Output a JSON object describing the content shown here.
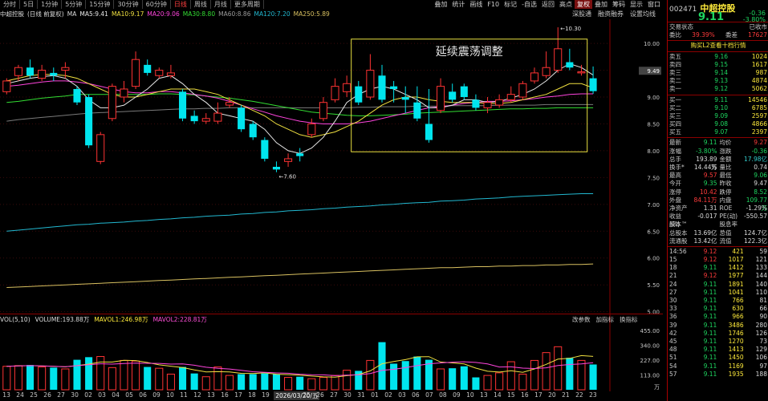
{
  "tabs": [
    "分时",
    "5日",
    "1分钟",
    "5分钟",
    "15分钟",
    "30分钟",
    "60分钟",
    "日线",
    "周线",
    "月线",
    "更多周期"
  ],
  "active_tab": "日线",
  "tools": [
    {
      "label": "叠加",
      "hl": false
    },
    {
      "label": "统计",
      "hl": false
    },
    {
      "label": "画线",
      "hl": false
    },
    {
      "label": "F10",
      "hl": false
    },
    {
      "label": "标记",
      "hl": false
    },
    {
      "label": "-自选",
      "hl": false
    },
    {
      "label": "返回",
      "hl": false
    },
    {
      "label": "高点",
      "hl": false
    },
    {
      "label": "复权",
      "hl": true
    },
    {
      "label": "叠加",
      "hl": false
    },
    {
      "label": "筹码",
      "hl": false
    },
    {
      "label": "显示",
      "hl": false
    },
    {
      "label": "窗口",
      "hl": false
    }
  ],
  "legend": {
    "name": "中超控股",
    "period": "(日线 前复权)",
    "ma": "MA",
    "ma5": "MA5:9.41",
    "ma10": "MA10:9.17",
    "ma20": "MA20:9.06",
    "ma30": "MA30:8.80",
    "ma60": "MA60:8.86",
    "ma120": "MA120:7.20",
    "ma250": "MA250:5.89"
  },
  "subbar": [
    "深股通",
    "融资融券",
    "设置均线"
  ],
  "annotation": "延续震荡调整",
  "price_labels": {
    "high": "10.30",
    "low": "7.60"
  },
  "yaxis": [
    "10.00",
    "9.50",
    "9.00",
    "8.50",
    "8.00",
    "7.50",
    "7.00",
    "6.50",
    "6.00",
    "5.50",
    "5.00"
  ],
  "current_price_tag": "9.49",
  "vol_legend": {
    "vol": "VOL(5,10)",
    "volume": "VOLUME:193.88万",
    "mavol1": "MAVOL1:246.98万",
    "mavol2": "MAVOL2:228.81万"
  },
  "vol_tools": [
    "改参数",
    "加指标",
    "换指标"
  ],
  "vol_yaxis": [
    "455.00",
    "340.00",
    "227.00",
    "113.00"
  ],
  "vol_unit": "万",
  "dates": [
    "13",
    "24",
    "25",
    "26",
    "27",
    "30",
    "02",
    "03",
    "04",
    "05",
    "06",
    "09",
    "10",
    "11",
    "12",
    "13",
    "16",
    "17",
    "18",
    "19",
    "20",
    "2026/03/20/五",
    "25",
    "26",
    "27",
    "30",
    "31",
    "01",
    "02",
    "03",
    "06",
    "07",
    "08",
    "09",
    "10",
    "13",
    "14",
    "15",
    "16",
    "17",
    "20",
    "21",
    "22",
    "23"
  ],
  "stock": {
    "code": "002471",
    "name": "中超控股",
    "price": "9.11",
    "change": "-0.36",
    "pct": "-3.80%"
  },
  "status": {
    "label": "交易状态",
    "value": "已收市"
  },
  "weibi": {
    "k1": "委比",
    "v1": "39.39%",
    "k2": "委差",
    "v2": "17627"
  },
  "l2": "购买L2查看十档行情",
  "asks": [
    {
      "l": "卖五",
      "p": "9.16",
      "v": "1024"
    },
    {
      "l": "卖四",
      "p": "9.15",
      "v": "1617"
    },
    {
      "l": "卖三",
      "p": "9.14",
      "v": "987"
    },
    {
      "l": "卖二",
      "p": "9.13",
      "v": "4874"
    },
    {
      "l": "卖一",
      "p": "9.12",
      "v": "5062"
    }
  ],
  "bids": [
    {
      "l": "买一",
      "p": "9.11",
      "v": "14546"
    },
    {
      "l": "买二",
      "p": "9.10",
      "v": "6785"
    },
    {
      "l": "买三",
      "p": "9.09",
      "v": "2597"
    },
    {
      "l": "买四",
      "p": "9.08",
      "v": "4866"
    },
    {
      "l": "买五",
      "p": "9.07",
      "v": "2397"
    }
  ],
  "stats": [
    {
      "k1": "最新",
      "v1": "9.11",
      "c1": "green",
      "k2": "均价",
      "v2": "9.27",
      "c2": "red"
    },
    {
      "k1": "涨幅",
      "v1": "-3.80%",
      "c1": "green",
      "k2": "涨跌",
      "v2": "-0.36",
      "c2": "green"
    },
    {
      "k1": "总手",
      "v1": "193.89万",
      "c1": "white",
      "k2": "金额",
      "v2": "17.98亿",
      "c2": "cyan"
    },
    {
      "k1": "换手*",
      "v1": "14.44%",
      "c1": "white",
      "k2": "量比",
      "v2": "0.74",
      "c2": "white"
    },
    {
      "k1": "最高",
      "v1": "9.57",
      "c1": "red",
      "k2": "最低",
      "v2": "9.06",
      "c2": "green"
    },
    {
      "k1": "今开",
      "v1": "9.35",
      "c1": "green",
      "k2": "昨收",
      "v2": "9.47",
      "c2": "white"
    },
    {
      "k1": "涨停",
      "v1": "10.42",
      "c1": "red",
      "k2": "跌停",
      "v2": "8.52",
      "c2": "green"
    },
    {
      "k1": "外盘",
      "v1": "84.11万",
      "c1": "red",
      "k2": "内盘",
      "v2": "109.77万",
      "c2": "green"
    },
    {
      "k1": "净资产",
      "v1": "1.31",
      "c1": "white",
      "k2": "ROE",
      "v2": "-1.29%",
      "c2": "white"
    },
    {
      "k1": "收益(四)",
      "v1": "-0.017",
      "c1": "white",
      "k2": "PE(动)",
      "v2": "-550.57",
      "c2": "white"
    },
    {
      "k1": "股本™",
      "v1": "",
      "c1": "white",
      "k2": "股息率™",
      "v2": "",
      "c2": "white"
    },
    {
      "k1": "总股本",
      "v1": "13.69亿",
      "c1": "white",
      "k2": "总值",
      "v2": "124.7亿",
      "c2": "white"
    },
    {
      "k1": "流通股",
      "v1": "13.42亿",
      "c1": "white",
      "k2": "流值",
      "v2": "122.3亿",
      "c2": "white"
    }
  ],
  "ticks": [
    {
      "t": "14:56",
      "p": "9.12",
      "v": "421",
      "c": "59",
      "pc": "red"
    },
    {
      "t": "15",
      "p": "9.12",
      "v": "1017",
      "c": "121",
      "pc": "red"
    },
    {
      "t": "18",
      "p": "9.11",
      "v": "1412",
      "c": "133",
      "pc": "green"
    },
    {
      "t": "21",
      "p": "9.12",
      "v": "1977",
      "c": "144",
      "pc": "red"
    },
    {
      "t": "24",
      "p": "9.11",
      "v": "1891",
      "c": "140",
      "pc": "green"
    },
    {
      "t": "27",
      "p": "9.11",
      "v": "1041",
      "c": "110",
      "pc": "green"
    },
    {
      "t": "30",
      "p": "9.11",
      "v": "766",
      "c": "81",
      "pc": "green"
    },
    {
      "t": "33",
      "p": "9.11",
      "v": "630",
      "c": "66",
      "pc": "green"
    },
    {
      "t": "36",
      "p": "9.11",
      "v": "966",
      "c": "90",
      "pc": "green"
    },
    {
      "t": "39",
      "p": "9.11",
      "v": "3486",
      "c": "280",
      "pc": "green"
    },
    {
      "t": "42",
      "p": "9.11",
      "v": "1746",
      "c": "126",
      "pc": "green"
    },
    {
      "t": "45",
      "p": "9.11",
      "v": "1270",
      "c": "73",
      "pc": "green"
    },
    {
      "t": "48",
      "p": "9.11",
      "v": "1413",
      "c": "129",
      "pc": "green"
    },
    {
      "t": "51",
      "p": "9.11",
      "v": "1450",
      "c": "106",
      "pc": "green"
    },
    {
      "t": "54",
      "p": "9.11",
      "v": "1169",
      "c": "97",
      "pc": "green"
    },
    {
      "t": "57",
      "p": "9.11",
      "v": "1935",
      "c": "188",
      "pc": "green"
    }
  ],
  "chart_data": {
    "type": "candlestick",
    "ylim": [
      4.95,
      10.45
    ],
    "vol_ylim": [
      0,
      455
    ],
    "candles": [
      {
        "o": 9.1,
        "c": 9.3,
        "h": 9.35,
        "l": 9.05
      },
      {
        "o": 9.4,
        "c": 9.55,
        "h": 9.6,
        "l": 9.3
      },
      {
        "o": 9.55,
        "c": 9.4,
        "h": 9.7,
        "l": 9.35
      },
      {
        "o": 9.35,
        "c": 9.5,
        "h": 9.6,
        "l": 9.3
      },
      {
        "o": 9.45,
        "c": 9.4,
        "h": 9.55,
        "l": 9.3
      },
      {
        "o": 9.5,
        "c": 9.55,
        "h": 9.65,
        "l": 9.35
      },
      {
        "o": 9.15,
        "c": 8.9,
        "h": 9.2,
        "l": 8.85
      },
      {
        "o": 9.0,
        "c": 8.1,
        "h": 9.05,
        "l": 8.05
      },
      {
        "o": 7.8,
        "c": 8.3,
        "h": 8.35,
        "l": 7.75
      },
      {
        "o": 8.6,
        "c": 9.2,
        "h": 9.25,
        "l": 8.55
      },
      {
        "o": 9.0,
        "c": 9.15,
        "h": 9.3,
        "l": 8.9
      },
      {
        "o": 9.2,
        "c": 9.7,
        "h": 9.85,
        "l": 9.15
      },
      {
        "o": 9.6,
        "c": 9.45,
        "h": 9.7,
        "l": 9.4
      },
      {
        "o": 9.4,
        "c": 9.5,
        "h": 9.55,
        "l": 9.35
      },
      {
        "o": 9.4,
        "c": 9.45,
        "h": 9.6,
        "l": 9.35
      },
      {
        "o": 9.1,
        "c": 8.6,
        "h": 9.15,
        "l": 8.55
      },
      {
        "o": 8.65,
        "c": 8.55,
        "h": 8.75,
        "l": 8.5
      },
      {
        "o": 8.55,
        "c": 8.6,
        "h": 8.7,
        "l": 8.5
      },
      {
        "o": 8.55,
        "c": 8.7,
        "h": 8.9,
        "l": 8.5
      },
      {
        "o": 8.85,
        "c": 8.9,
        "h": 9.0,
        "l": 8.8
      },
      {
        "o": 8.8,
        "c": 8.4,
        "h": 8.85,
        "l": 8.35
      },
      {
        "o": 8.5,
        "c": 8.25,
        "h": 8.55,
        "l": 8.2
      },
      {
        "o": 8.2,
        "c": 7.85,
        "h": 8.25,
        "l": 7.8
      },
      {
        "o": 7.7,
        "c": 7.65,
        "h": 7.8,
        "l": 7.6
      },
      {
        "o": 7.8,
        "c": 7.85,
        "h": 7.95,
        "l": 7.7
      },
      {
        "o": 7.95,
        "c": 7.9,
        "h": 8.05,
        "l": 7.8
      },
      {
        "o": 8.3,
        "c": 8.5,
        "h": 8.6,
        "l": 8.25
      },
      {
        "o": 8.6,
        "c": 8.9,
        "h": 9.0,
        "l": 8.55
      },
      {
        "o": 8.95,
        "c": 9.2,
        "h": 9.35,
        "l": 8.9
      },
      {
        "o": 9.1,
        "c": 9.25,
        "h": 9.4,
        "l": 9.0
      },
      {
        "o": 9.2,
        "c": 8.9,
        "h": 9.3,
        "l": 8.85
      },
      {
        "o": 9.0,
        "c": 9.5,
        "h": 9.8,
        "l": 8.95
      },
      {
        "o": 9.4,
        "c": 8.95,
        "h": 9.6,
        "l": 8.9
      },
      {
        "o": 9.2,
        "c": 9.15,
        "h": 9.3,
        "l": 8.9
      },
      {
        "o": 9.0,
        "c": 8.95,
        "h": 9.2,
        "l": 8.7
      },
      {
        "o": 8.9,
        "c": 8.6,
        "h": 9.2,
        "l": 8.55
      },
      {
        "o": 8.5,
        "c": 8.2,
        "h": 9.15,
        "l": 8.15
      },
      {
        "o": 8.75,
        "c": 9.2,
        "h": 9.35,
        "l": 8.7
      },
      {
        "o": 9.1,
        "c": 8.95,
        "h": 9.25,
        "l": 8.9
      },
      {
        "o": 9.2,
        "c": 9.0,
        "h": 9.25,
        "l": 8.95
      },
      {
        "o": 8.95,
        "c": 8.8,
        "h": 9.05,
        "l": 8.75
      },
      {
        "o": 8.8,
        "c": 8.9,
        "h": 9.0,
        "l": 8.7
      },
      {
        "o": 8.85,
        "c": 8.95,
        "h": 9.05,
        "l": 8.8
      },
      {
        "o": 8.95,
        "c": 9.05,
        "h": 9.2,
        "l": 8.9
      },
      {
        "o": 9.0,
        "c": 9.25,
        "h": 9.3,
        "l": 8.95
      },
      {
        "o": 9.3,
        "c": 9.45,
        "h": 9.55,
        "l": 9.25
      },
      {
        "o": 9.4,
        "c": 9.55,
        "h": 9.85,
        "l": 9.35
      },
      {
        "o": 9.5,
        "c": 9.9,
        "h": 10.3,
        "l": 9.45
      },
      {
        "o": 9.65,
        "c": 9.55,
        "h": 9.9,
        "l": 9.5
      },
      {
        "o": 9.45,
        "c": 9.47,
        "h": 9.6,
        "l": 9.4
      },
      {
        "o": 9.35,
        "c": 9.11,
        "h": 9.57,
        "l": 9.06
      }
    ],
    "volumes": [
      180,
      185,
      190,
      175,
      170,
      160,
      230,
      250,
      255,
      170,
      225,
      220,
      175,
      165,
      120,
      175,
      125,
      100,
      175,
      110,
      120,
      120,
      125,
      120,
      95,
      100,
      85,
      95,
      110,
      150,
      145,
      225,
      365,
      200,
      220,
      255,
      230,
      160,
      165,
      180,
      95,
      110,
      130,
      215,
      120,
      225,
      285,
      330,
      245,
      225,
      193.88
    ],
    "ma5": [
      9.25,
      9.3,
      9.35,
      9.38,
      9.4,
      9.35,
      9.2,
      8.95,
      8.8,
      8.8,
      8.85,
      9.0,
      9.15,
      9.35,
      9.4,
      9.25,
      9.05,
      8.9,
      8.7,
      8.65,
      8.6,
      8.55,
      8.4,
      8.15,
      8.0,
      7.95,
      8.05,
      8.25,
      8.55,
      8.9,
      9.05,
      9.15,
      9.2,
      9.15,
      9.05,
      8.95,
      8.8,
      8.8,
      8.85,
      8.95,
      8.95,
      8.9,
      8.92,
      8.98,
      9.05,
      9.15,
      9.3,
      9.5,
      9.62,
      9.55,
      9.41
    ],
    "ma10": [
      9.3,
      9.35,
      9.4,
      9.42,
      9.42,
      9.4,
      9.35,
      9.25,
      9.15,
      9.05,
      9.0,
      9.0,
      9.05,
      9.1,
      9.15,
      9.15,
      9.15,
      9.1,
      9.05,
      8.95,
      8.85,
      8.75,
      8.65,
      8.5,
      8.4,
      8.3,
      8.25,
      8.3,
      8.35,
      8.45,
      8.55,
      8.7,
      8.85,
      8.95,
      9.0,
      9.0,
      8.95,
      8.92,
      8.9,
      8.9,
      8.9,
      8.88,
      8.88,
      8.9,
      8.95,
      9.0,
      9.05,
      9.15,
      9.25,
      9.25,
      9.17
    ],
    "ma20": [
      9.2,
      9.22,
      9.25,
      9.28,
      9.3,
      9.3,
      9.28,
      9.25,
      9.2,
      9.15,
      9.1,
      9.08,
      9.08,
      9.1,
      9.1,
      9.08,
      9.05,
      9.02,
      8.98,
      8.92,
      8.85,
      8.78,
      8.72,
      8.65,
      8.6,
      8.55,
      8.52,
      8.5,
      8.5,
      8.5,
      8.52,
      8.55,
      8.6,
      8.65,
      8.7,
      8.75,
      8.8,
      8.82,
      8.85,
      8.88,
      8.9,
      8.92,
      8.92,
      8.93,
      8.95,
      8.97,
      9.0,
      9.02,
      9.05,
      9.06,
      9.06
    ],
    "ma30": [
      8.9,
      8.92,
      8.95,
      8.98,
      9.0,
      9.02,
      9.05,
      9.05,
      9.05,
      9.05,
      9.05,
      9.05,
      9.05,
      9.06,
      9.06,
      9.05,
      9.04,
      9.02,
      9.0,
      8.98,
      8.95,
      8.92,
      8.88,
      8.84,
      8.8,
      8.76,
      8.72,
      8.7,
      8.68,
      8.66,
      8.65,
      8.65,
      8.66,
      8.67,
      8.68,
      8.7,
      8.71,
      8.72,
      8.73,
      8.74,
      8.75,
      8.76,
      8.77,
      8.78,
      8.78,
      8.79,
      8.79,
      8.8,
      8.8,
      8.8,
      8.8
    ],
    "ma60": [
      8.55,
      8.58,
      8.6,
      8.62,
      8.64,
      8.66,
      8.68,
      8.7,
      8.71,
      8.72,
      8.73,
      8.74,
      8.75,
      8.76,
      8.77,
      8.78,
      8.78,
      8.79,
      8.79,
      8.8,
      8.8,
      8.8,
      8.8,
      8.8,
      8.8,
      8.8,
      8.8,
      8.8,
      8.8,
      8.8,
      8.81,
      8.81,
      8.82,
      8.82,
      8.82,
      8.83,
      8.83,
      8.83,
      8.84,
      8.84,
      8.84,
      8.84,
      8.85,
      8.85,
      8.85,
      8.85,
      8.86,
      8.86,
      8.86,
      8.86,
      8.86
    ],
    "ma120": [
      6.5,
      6.52,
      6.54,
      6.56,
      6.58,
      6.6,
      6.62,
      6.63,
      6.65,
      6.66,
      6.67,
      6.69,
      6.7,
      6.72,
      6.73,
      6.75,
      6.76,
      6.78,
      6.79,
      6.8,
      6.82,
      6.83,
      6.85,
      6.86,
      6.88,
      6.89,
      6.9,
      6.92,
      6.93,
      6.95,
      6.96,
      6.97,
      6.99,
      7.0,
      7.02,
      7.03,
      7.04,
      7.06,
      7.07,
      7.08,
      7.1,
      7.11,
      7.12,
      7.14,
      7.15,
      7.16,
      7.17,
      7.18,
      7.19,
      7.2,
      7.2
    ],
    "ma250": [
      5.45,
      5.46,
      5.47,
      5.48,
      5.49,
      5.5,
      5.51,
      5.52,
      5.53,
      5.54,
      5.55,
      5.56,
      5.57,
      5.58,
      5.59,
      5.6,
      5.61,
      5.62,
      5.63,
      5.64,
      5.65,
      5.66,
      5.67,
      5.68,
      5.69,
      5.7,
      5.71,
      5.72,
      5.73,
      5.74,
      5.75,
      5.76,
      5.77,
      5.78,
      5.79,
      5.8,
      5.81,
      5.82,
      5.82,
      5.83,
      5.84,
      5.84,
      5.85,
      5.85,
      5.86,
      5.86,
      5.87,
      5.87,
      5.88,
      5.88,
      5.89
    ]
  },
  "colors": {
    "up": "#ff3333",
    "down": "#00e5ee",
    "ma5": "#e8e8e8",
    "ma10": "#f0e040",
    "ma20": "#ff44dd",
    "ma30": "#33dd33",
    "ma60": "#7a7a7a",
    "ma120": "#22b8d0",
    "ma250": "#d8c060"
  }
}
